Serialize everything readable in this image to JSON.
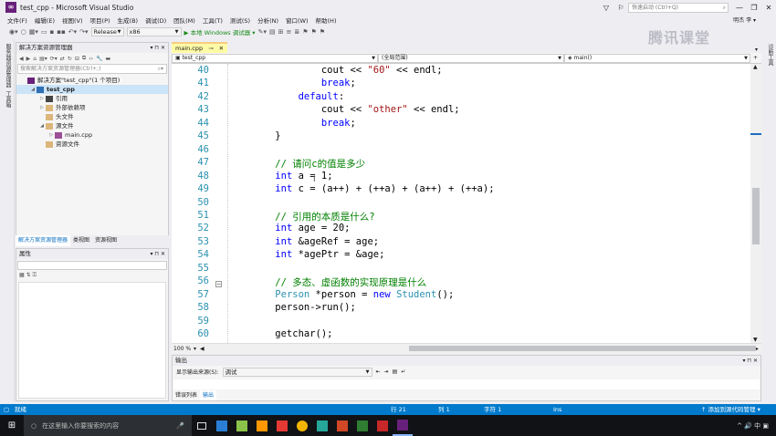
{
  "window": {
    "title": "test_cpp - Microsoft Visual Studio",
    "quick_launch": "快速启动 (Ctrl+Q)",
    "user": "明杰 李 ▾"
  },
  "menu": [
    "文件(F)",
    "编辑(E)",
    "视图(V)",
    "项目(P)",
    "生成(B)",
    "调试(D)",
    "团队(M)",
    "工具(T)",
    "测试(S)",
    "分析(N)",
    "窗口(W)",
    "帮助(H)"
  ],
  "toolbar": {
    "config": "Release",
    "platform": "x86",
    "run_label": "▶ 本地 Windows 调试器 ▾"
  },
  "left_strip_labels": [
    "服务器资源管理器",
    "工具箱"
  ],
  "right_strip_label": "诊断工具",
  "solution_explorer": {
    "title": "解决方案资源管理器",
    "search_placeholder": "搜索解决方案资源管理器(Ctrl+;)",
    "items": [
      {
        "label": "解决方案\"test_cpp\"(1 个项目)",
        "level": 0,
        "icon": "solution-icon",
        "arrow": ""
      },
      {
        "label": "test_cpp",
        "level": 1,
        "icon": "project-icon",
        "arrow": "◢"
      },
      {
        "label": "引用",
        "level": 2,
        "icon": "references-icon",
        "arrow": "▷"
      },
      {
        "label": "外部依赖项",
        "level": 2,
        "icon": "folder-icon",
        "arrow": "▷"
      },
      {
        "label": "头文件",
        "level": 2,
        "icon": "folder-icon",
        "arrow": ""
      },
      {
        "label": "源文件",
        "level": 2,
        "icon": "folder-icon",
        "arrow": "◢"
      },
      {
        "label": "main.cpp",
        "level": 3,
        "icon": "cpp-file-icon",
        "arrow": "▷"
      },
      {
        "label": "资源文件",
        "level": 2,
        "icon": "folder-icon",
        "arrow": ""
      }
    ],
    "tabs": [
      "解决方案资源管理器",
      "类视图",
      "资源视图"
    ]
  },
  "properties": {
    "title": "属性"
  },
  "editor": {
    "tab": "main.cpp",
    "nav": [
      "test_cpp",
      "(全局范围)",
      "main()"
    ],
    "zoom": "100 %",
    "lines": [
      {
        "n": "40",
        "tokens": [
          [
            "plain",
            "            cout << "
          ],
          [
            "str",
            "\"60\""
          ],
          [
            "plain",
            " << endl;"
          ]
        ]
      },
      {
        "n": "41",
        "tokens": [
          [
            "plain",
            "            "
          ],
          [
            "kw",
            "break"
          ],
          [
            "plain",
            ";"
          ]
        ]
      },
      {
        "n": "42",
        "tokens": [
          [
            "plain",
            "        "
          ],
          [
            "kw",
            "default"
          ],
          [
            "plain",
            ":"
          ]
        ]
      },
      {
        "n": "43",
        "tokens": [
          [
            "plain",
            "            cout << "
          ],
          [
            "str",
            "\"other\""
          ],
          [
            "plain",
            " << endl;"
          ]
        ]
      },
      {
        "n": "44",
        "tokens": [
          [
            "plain",
            "            "
          ],
          [
            "kw",
            "break"
          ],
          [
            "plain",
            ";"
          ]
        ]
      },
      {
        "n": "45",
        "tokens": [
          [
            "plain",
            "    }"
          ]
        ]
      },
      {
        "n": "46",
        "tokens": []
      },
      {
        "n": "47",
        "tokens": [
          [
            "plain",
            "    "
          ],
          [
            "cm",
            "// 请问c的值是多少"
          ]
        ]
      },
      {
        "n": "48",
        "tokens": [
          [
            "plain",
            "    "
          ],
          [
            "kw",
            "int"
          ],
          [
            "plain",
            " a = 1;"
          ]
        ]
      },
      {
        "n": "49",
        "tokens": [
          [
            "plain",
            "    "
          ],
          [
            "kw",
            "int"
          ],
          [
            "plain",
            " c = (a++) + (++a) + (a++) + (++a);"
          ]
        ]
      },
      {
        "n": "50",
        "tokens": []
      },
      {
        "n": "51",
        "tokens": [
          [
            "plain",
            "    "
          ],
          [
            "cm",
            "// 引用的本质是什么?"
          ]
        ]
      },
      {
        "n": "52",
        "tokens": [
          [
            "plain",
            "    "
          ],
          [
            "kw",
            "int"
          ],
          [
            "plain",
            " age = 20;"
          ]
        ]
      },
      {
        "n": "53",
        "tokens": [
          [
            "plain",
            "    "
          ],
          [
            "kw",
            "int"
          ],
          [
            "plain",
            " &ageRef = age;"
          ]
        ]
      },
      {
        "n": "54",
        "tokens": [
          [
            "plain",
            "    "
          ],
          [
            "kw",
            "int"
          ],
          [
            "plain",
            " *agePtr = &age;"
          ]
        ]
      },
      {
        "n": "55",
        "tokens": []
      },
      {
        "n": "56",
        "tokens": [
          [
            "plain",
            "    "
          ],
          [
            "cm",
            "// 多态、虚函数的实现原理是什么"
          ]
        ]
      },
      {
        "n": "57",
        "tokens": [
          [
            "plain",
            "    "
          ],
          [
            "ty",
            "Person"
          ],
          [
            "plain",
            " *person = "
          ],
          [
            "kw",
            "new"
          ],
          [
            "plain",
            " "
          ],
          [
            "ty",
            "Student"
          ],
          [
            "plain",
            "();"
          ]
        ]
      },
      {
        "n": "58",
        "tokens": [
          [
            "plain",
            "    person->run();"
          ]
        ]
      },
      {
        "n": "59",
        "tokens": []
      },
      {
        "n": "60",
        "tokens": [
          [
            "plain",
            "    getchar();"
          ]
        ]
      }
    ]
  },
  "output": {
    "title": "输出",
    "source_label": "显示输出来源(S):",
    "source_value": "调试",
    "tabs": [
      "错误列表",
      "输出"
    ]
  },
  "status": {
    "left": "就绪",
    "line": "行 21",
    "col": "列 1",
    "ch": "字符 1",
    "mode": "Ins",
    "right": "↑ 添加到源代码管理 ▾"
  },
  "taskbar": {
    "search_placeholder": "在这里输入你要搜索的内容",
    "tray": "^ 🔊 中 ▣"
  },
  "watermark": "腾讯课堂"
}
